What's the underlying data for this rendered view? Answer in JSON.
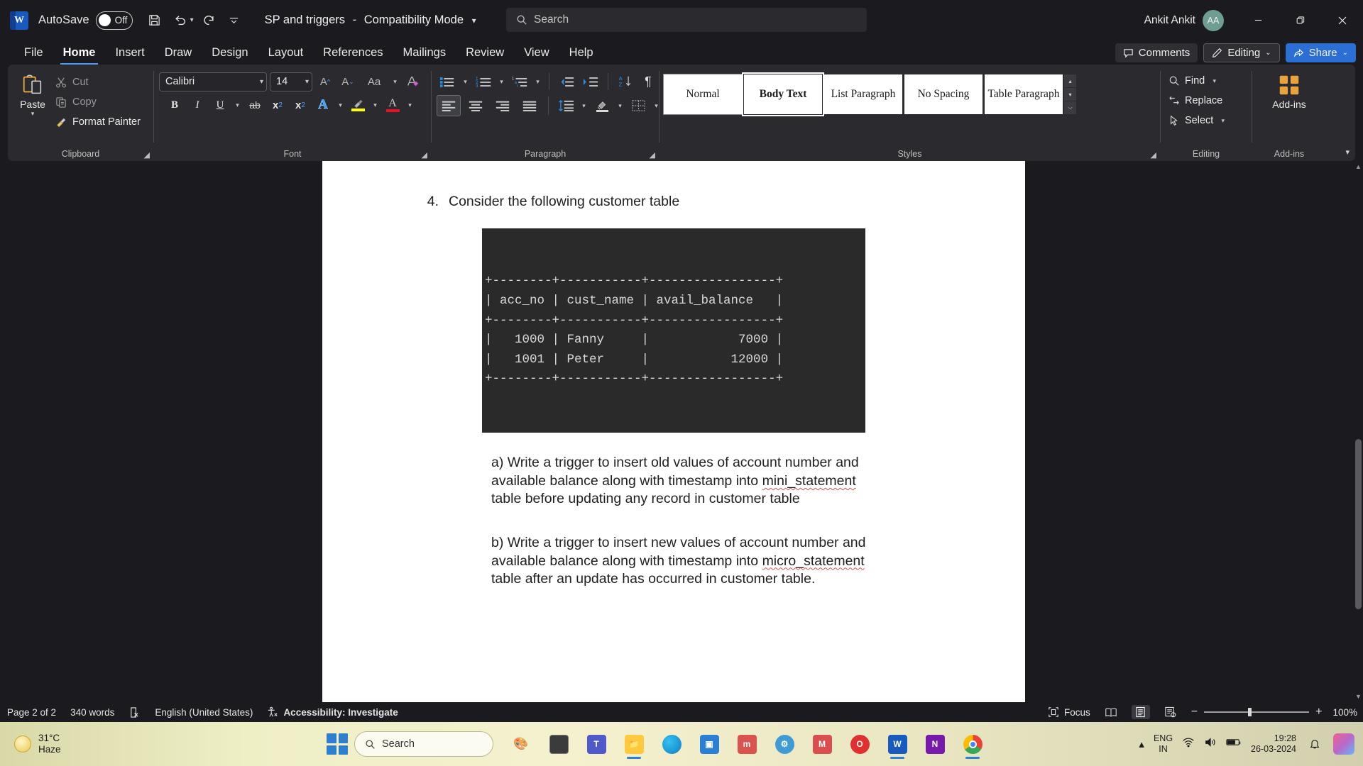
{
  "titlebar": {
    "app_logo": "word-logo",
    "logo_letter": "W",
    "autosave_label": "AutoSave",
    "autosave_state": "Off",
    "save_icon": "save-icon",
    "undo_icon": "undo-icon",
    "redo_icon": "redo-icon",
    "customize_icon": "customize-quick-access-icon",
    "document_title": "SP and triggers",
    "title_separator": "-",
    "compatibility_mode": "Compatibility Mode",
    "search_placeholder": "Search",
    "search_icon": "search-icon",
    "user_name": "Ankit Ankit",
    "user_initials": "AA",
    "minimize_label": "Minimize",
    "restore_label": "Restore Down",
    "close_label": "Close"
  },
  "tabs": [
    {
      "label": "File",
      "active": false
    },
    {
      "label": "Home",
      "active": true
    },
    {
      "label": "Insert",
      "active": false
    },
    {
      "label": "Draw",
      "active": false
    },
    {
      "label": "Design",
      "active": false
    },
    {
      "label": "Layout",
      "active": false
    },
    {
      "label": "References",
      "active": false
    },
    {
      "label": "Mailings",
      "active": false
    },
    {
      "label": "Review",
      "active": false
    },
    {
      "label": "View",
      "active": false
    },
    {
      "label": "Help",
      "active": false
    }
  ],
  "tabbar_right": {
    "comments_label": "Comments",
    "comments_icon": "comment-icon",
    "editing_label": "Editing",
    "editing_icon": "pencil-icon",
    "share_label": "Share",
    "share_icon": "share-icon",
    "chevron": "⌄"
  },
  "ribbon": {
    "clipboard": {
      "group_label": "Clipboard",
      "paste_label": "Paste",
      "paste_icon": "paste-icon",
      "cut_label": "Cut",
      "cut_icon": "scissors-icon",
      "copy_label": "Copy",
      "copy_icon": "copy-icon",
      "format_painter_label": "Format Painter",
      "format_painter_icon": "paintbrush-icon",
      "dialog_launcher": "clipboard-dialog-launcher"
    },
    "font": {
      "group_label": "Font",
      "font_family_value": "Calibri",
      "font_size_value": "14",
      "grow_font_icon": "grow-font-icon",
      "shrink_font_icon": "shrink-font-icon",
      "change_case_icon": "change-case-icon",
      "change_case_label": "Aa",
      "clear_formatting_icon": "clear-formatting-icon",
      "bold_label": "B",
      "italic_label": "I",
      "underline_label": "U",
      "strikethrough_label": "ab",
      "subscript_label": "x",
      "subscript_sub": "2",
      "superscript_label": "x",
      "superscript_sup": "2",
      "text_effects_icon": "text-effects-icon",
      "text_highlight_icon": "text-highlight-icon",
      "text_highlight_color": "#ffff00",
      "font_color_icon": "font-color-icon",
      "font_color": "#e81123",
      "dialog_launcher": "font-dialog-launcher"
    },
    "paragraph": {
      "group_label": "Paragraph",
      "bullets_icon": "bullet-list-icon",
      "numbering_icon": "numbered-list-icon",
      "multilevel_icon": "multilevel-list-icon",
      "decrease_indent_icon": "decrease-indent-icon",
      "increase_indent_icon": "increase-indent-icon",
      "sort_icon": "sort-icon",
      "show_marks_icon": "paragraph-marks-icon",
      "align_left_icon": "align-left-icon",
      "align_center_icon": "align-center-icon",
      "align_right_icon": "align-right-icon",
      "justify_icon": "justify-icon",
      "line_spacing_icon": "line-spacing-icon",
      "shading_icon": "shading-icon",
      "borders_icon": "borders-icon",
      "dialog_launcher": "paragraph-dialog-launcher"
    },
    "styles": {
      "group_label": "Styles",
      "items": [
        {
          "label": "Normal",
          "selected": false
        },
        {
          "label": "Body Text",
          "selected": true
        },
        {
          "label": "List Paragraph",
          "selected": false
        },
        {
          "label": "No Spacing",
          "selected": false
        },
        {
          "label": "Table Paragraph",
          "selected": false
        }
      ],
      "scroll_up": "▴",
      "scroll_down": "▾",
      "more": "⌵",
      "dialog_launcher": "styles-dialog-launcher"
    },
    "editing": {
      "group_label": "Editing",
      "find_label": "Find",
      "find_icon": "find-icon",
      "replace_label": "Replace",
      "replace_icon": "replace-icon",
      "select_label": "Select",
      "select_icon": "select-icon"
    },
    "addins": {
      "group_label": "Add-ins",
      "addins_label": "Add-ins",
      "addins_icon": "addins-grid-icon"
    },
    "collapse_icon": "collapse-ribbon-icon"
  },
  "document": {
    "question_number": "4.",
    "question_text": "Consider the following customer table",
    "table_text": "+--------+-----------+-----------------+\n| acc_no | cust_name | avail_balance   |\n+--------+-----------+-----------------+\n|   1000 | Fanny     |            7000 |\n|   1001 | Peter     |           12000 |\n+--------+-----------+-----------------+",
    "paragraph_a_pre": "a) Write a trigger to insert old values of account number and available balance along with timestamp into ",
    "paragraph_a_term": "mini_statement",
    "paragraph_a_post": " table before updating any record in customer table",
    "paragraph_b_pre": "b) Write a trigger to insert new values of account number and available balance along with timestamp into ",
    "paragraph_b_term": "micro_statement",
    "paragraph_b_post": " table after an update has occurred in customer table."
  },
  "statusbar": {
    "page_info": "Page 2 of 2",
    "word_count": "340 words",
    "proofing_icon": "proofing-errors-icon",
    "language": "English (United States)",
    "accessibility_icon": "accessibility-icon",
    "accessibility_label": "Accessibility: Investigate",
    "focus_label": "Focus",
    "focus_icon": "focus-icon",
    "read_mode_icon": "read-mode-icon",
    "print_layout_icon": "print-layout-icon",
    "web_layout_icon": "web-layout-icon",
    "zoom_out": "−",
    "zoom_in": "+",
    "zoom_level": "100%"
  },
  "taskbar": {
    "weather_temp": "31°C",
    "weather_desc": "Haze",
    "weather_icon": "sun-icon",
    "start_icon": "windows-start-icon",
    "search_placeholder": "Search",
    "search_icon": "search-icon",
    "apps": [
      {
        "name": "paint-app",
        "glyph": "🎨",
        "color": "#f2f2f2",
        "active": false
      },
      {
        "name": "task-view-app",
        "glyph": "▭",
        "color": "#3b3b3b",
        "active": false
      },
      {
        "name": "teams-app",
        "glyph": "T",
        "color": "#5059c9",
        "active": false
      },
      {
        "name": "file-explorer-app",
        "glyph": "📁",
        "color": "#ffc83d",
        "active": true
      },
      {
        "name": "edge-browser-app",
        "glyph": "e",
        "color": "#0f7dc2",
        "active": false
      },
      {
        "name": "store-app",
        "glyph": "▣",
        "color": "#2b7fd4",
        "active": false
      },
      {
        "name": "mysql-workbench-app",
        "glyph": "m",
        "color": "#d9534f",
        "active": false
      },
      {
        "name": "settings-app",
        "glyph": "⚙",
        "color": "#3f9bd4",
        "active": false
      },
      {
        "name": "mozilla-app",
        "glyph": "M",
        "color": "#d94f4f",
        "active": false
      },
      {
        "name": "opera-app",
        "glyph": "O",
        "color": "#e03030",
        "active": false
      },
      {
        "name": "word-app",
        "glyph": "W",
        "color": "#185abd",
        "active": true
      },
      {
        "name": "onenote-app",
        "glyph": "N",
        "color": "#7719aa",
        "active": false
      },
      {
        "name": "chrome-app",
        "glyph": "●",
        "color": "#4285f4",
        "active": true
      }
    ],
    "show_hidden_icon": "show-hidden-icons-chevron",
    "language_line1": "ENG",
    "language_line2": "IN",
    "wifi_icon": "wifi-icon",
    "volume_icon": "volume-icon",
    "battery_icon": "battery-icon",
    "clock_time": "19:28",
    "clock_date": "26-03-2024",
    "notification_icon": "notification-bell-icon",
    "copilot_icon": "copilot-icon"
  },
  "colors": {
    "chrome_bg": "#1b1b1f",
    "ribbon_bg": "#2b2b2f",
    "accent_blue": "#2b6fd4",
    "tab_underline": "#4a9eff",
    "page_white": "#ffffff",
    "code_bg": "#2a2a2a"
  }
}
